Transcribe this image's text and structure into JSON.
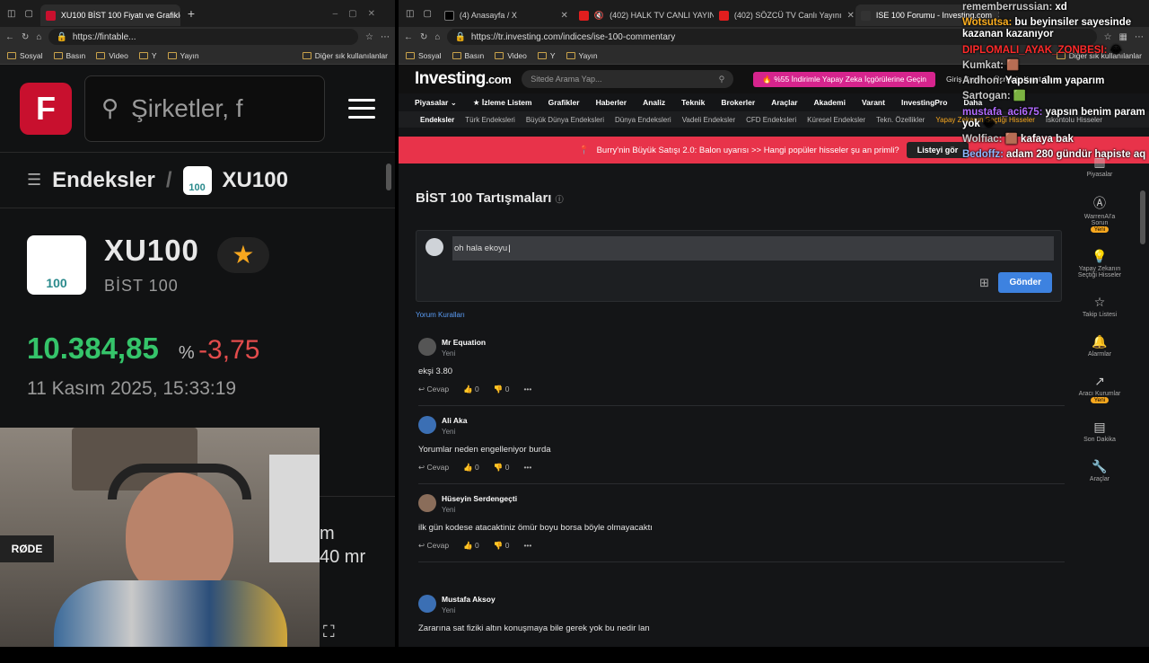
{
  "left_window": {
    "tabs": [
      {
        "title": "XU100 BİST 100 Fiyatı ve Grafikleri",
        "active": true
      }
    ],
    "url": "https://fintable...",
    "favorites": [
      "Sosyal",
      "Basın",
      "Video",
      "Y",
      "Yayın"
    ],
    "favorites_other": "Diğer sık kullanılanlar",
    "app": {
      "logo_letter": "F",
      "search_placeholder": "Şirketler, f",
      "breadcrumb": {
        "section": "Endeksler",
        "badge": "100",
        "current": "XU100"
      },
      "ticker": "XU100",
      "name": "BİST 100",
      "price": "10.384,85",
      "pct_symbol": "%",
      "change": "-3,75",
      "date": "11 Kasım 2025, 15:33:19",
      "card_label": "m",
      "card_value": "40 mr"
    }
  },
  "right_window": {
    "tabs": [
      {
        "title": "(4) Anasayfa / X",
        "active": false
      },
      {
        "title": "(402) HALK TV CANLI YAYIN",
        "active": false
      },
      {
        "title": "(402) SÖZCÜ TV Canlı Yayını",
        "active": false
      },
      {
        "title": "ISE 100 Forumu - Investing.com",
        "active": true
      }
    ],
    "url": "https://tr.investing.com/indices/ise-100-commentary",
    "favorites": [
      "Sosyal",
      "Basın",
      "Video",
      "Y",
      "Yayın"
    ],
    "favorites_other": "Diğer sık kullanılanlar",
    "site": {
      "logo": "Investing",
      "logo_suffix": ".com",
      "search_placeholder": "Sitede Arama Yap...",
      "promo": "%55 İndirimle Yapay Zeka İçgörülerine Geçin",
      "login": "Giriş Yapın",
      "signup": "Ücretsiz Kayıt Olun",
      "nav": [
        "Piyasalar",
        "İzleme Listem",
        "Grafikler",
        "Haberler",
        "Analiz",
        "Teknik",
        "Brokerler",
        "Araçlar",
        "Akademi",
        "Varant",
        "InvestingPro",
        "Daha"
      ],
      "subnav": [
        "Endeksler",
        "Türk Endeksleri",
        "Büyük Dünya Endeksleri",
        "Dünya Endeksleri",
        "Vadeli Endeksler",
        "CFD Endeksleri",
        "Küresel Endeksler",
        "Tekn. Özellikler",
        "Yapay Zekanın Seçtiği Hisseler",
        "İskontolu Hisseler"
      ],
      "banner_text": "Burry'nin Büyük Satışı 2.0: Balon uyarısı >> Hangi popüler hisseler şu an primli?",
      "banner_button": "Listeyi gör",
      "page_title": "BİST 100 Tartışmaları",
      "composer_text": "oh hala ekoyu",
      "send_button": "Gönder",
      "rules_link": "Yorum Kuralları",
      "comments": [
        {
          "author": "Mr Equation",
          "tag": "Yeni",
          "text": "ekşi 3.80",
          "reply": "Cevap",
          "likes": "0",
          "dislikes": "0"
        },
        {
          "author": "Ali Aka",
          "tag": "Yeni",
          "text": "Yorumlar neden engelleniyor burda",
          "reply": "Cevap",
          "likes": "0",
          "dislikes": "0"
        },
        {
          "author": "Hüseyin Serdengeçti",
          "tag": "Yeni",
          "text": "ilk gün kodese atacaktiniz ömür boyu borsa böyle olmayacaktı",
          "reply": "Cevap",
          "likes": "0",
          "dislikes": "0"
        },
        {
          "author": "Mustafa Aksoy",
          "tag": "Yeni",
          "text": "Zararına sat fiziki altın konuşmaya bile gerek yok bu nedir lan",
          "reply": "",
          "likes": "",
          "dislikes": ""
        }
      ],
      "rail": [
        {
          "label": "Piyasalar",
          "icon": "bars-icon",
          "new": false
        },
        {
          "label": "WarrenAI'a Sorun",
          "icon": "ai-icon",
          "new": true
        },
        {
          "label": "Yapay Zekanın Seçtiği Hisseler",
          "icon": "bulb-icon",
          "new": false
        },
        {
          "label": "Takip Listesi",
          "icon": "star-icon",
          "new": false
        },
        {
          "label": "Alarmlar",
          "icon": "bell-icon",
          "new": false
        },
        {
          "label": "Aracı Kurumlar",
          "icon": "chart-icon",
          "new": true
        },
        {
          "label": "Son Dakika",
          "icon": "doc-icon",
          "new": false
        },
        {
          "label": "Araçlar",
          "icon": "wrench-icon",
          "new": false
        }
      ],
      "rail_new_label": "Yeni"
    }
  },
  "chat": [
    {
      "user": "rememberrussian:",
      "msg": "xd",
      "color": "#c9c9c9"
    },
    {
      "user": "Wotsutsa:",
      "msg": "bu beyinsiler sayesinde kazanan kazanıyor",
      "color": "#ffb020"
    },
    {
      "user": "DIPLOMALI_AYAK_ZONBESI:",
      "msg": "",
      "color": "#ff2b2b"
    },
    {
      "user": "Kumkat:",
      "msg": "",
      "color": "#c9c9c9"
    },
    {
      "user": "Ardhon:",
      "msg": "Yapsın alım yaparım",
      "color": "#c9c9c9"
    },
    {
      "user": "Sartogan:",
      "msg": "",
      "color": "#c9c9c9"
    },
    {
      "user": "mustafa_aci675:",
      "msg": "yapsın benim param yok",
      "color": "#b26bff"
    },
    {
      "user": "Wolfiac:",
      "msg": "kafaya bak",
      "color": "#c9c9c9"
    },
    {
      "user": "Bedoffz:",
      "msg": "adam 280 gündür hapiste aq",
      "color": "#8fb8ff"
    }
  ],
  "colors": {
    "finance_red": "#c8102e",
    "up_green": "#35c46a",
    "down_red": "#e34c4c",
    "send_blue": "#3d82e0",
    "banner_red": "#e8334a"
  }
}
